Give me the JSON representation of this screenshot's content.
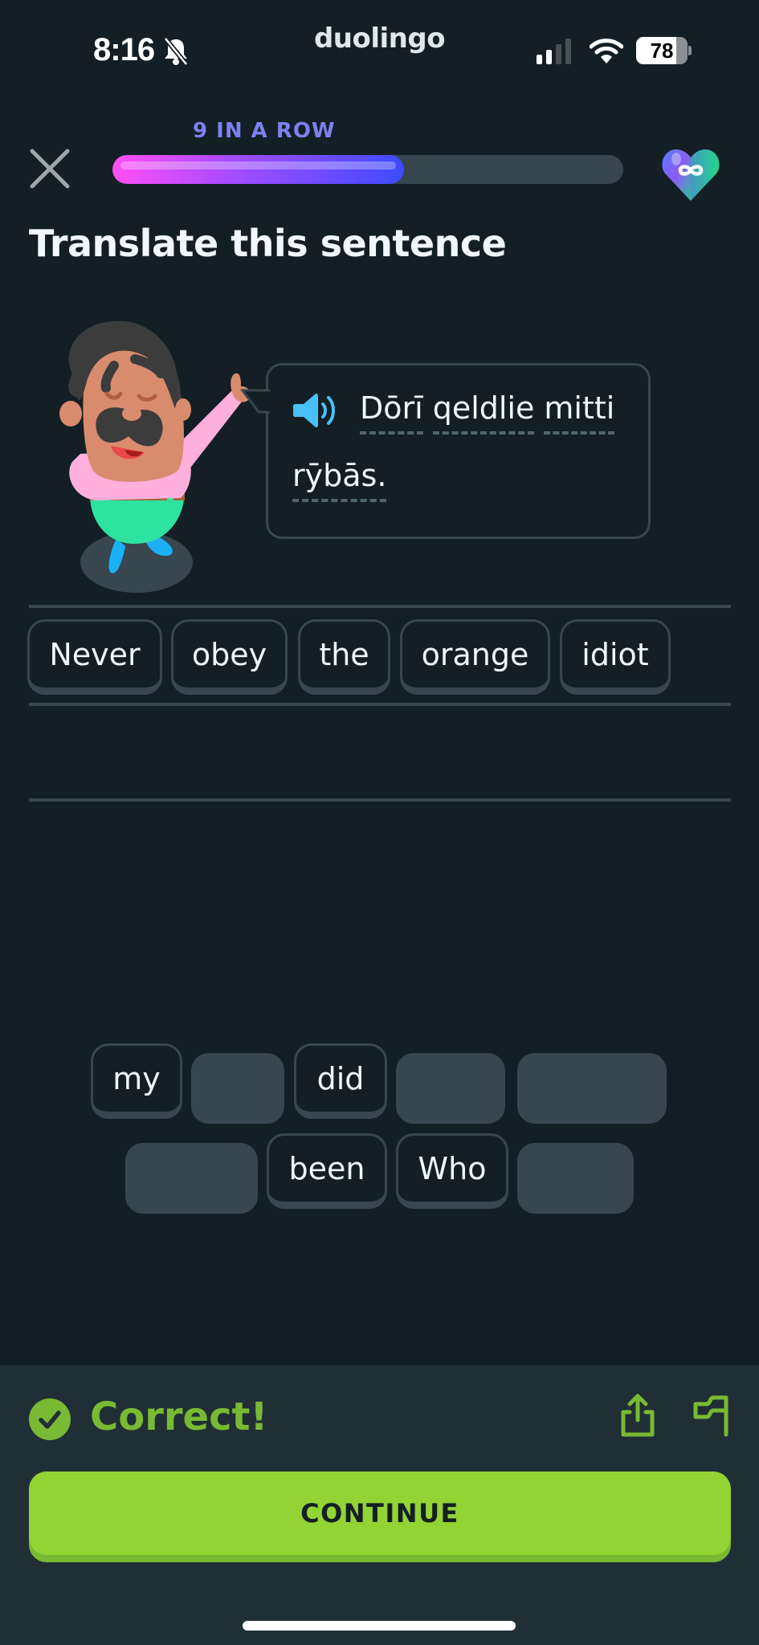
{
  "status_bar": {
    "time": "8:16",
    "app_name": "duolingo",
    "battery_percent": "78",
    "battery_level": 0.78,
    "icons": [
      "bell-slash-icon",
      "cellular-signal-icon",
      "wifi-icon",
      "battery-icon"
    ]
  },
  "header": {
    "streak_label": "9 IN A ROW",
    "lesson_progress": 0.57,
    "close_icon": "close-icon",
    "hearts_icon": "infinite-hearts-icon",
    "colors": {
      "streak": "#7c81f2",
      "progress_start": "#ff4ff5",
      "progress_end": "#3d4bff"
    }
  },
  "challenge": {
    "title": "Translate this sentence",
    "speaker_icon": "speaker-icon",
    "sentence_line1": [
      "Dōrī",
      "qeldlie",
      "mitti"
    ],
    "sentence_line2": [
      "rȳbās."
    ]
  },
  "answer": {
    "selected_words": [
      "Never",
      "obey",
      "the",
      "orange",
      "idiot"
    ]
  },
  "word_bank": {
    "row1": [
      {
        "word": "my",
        "used": false
      },
      {
        "word": "",
        "used": true
      },
      {
        "word": "did",
        "used": false
      },
      {
        "word": "",
        "used": true
      },
      {
        "word": "",
        "used": true
      }
    ],
    "row2": [
      {
        "word": "",
        "used": true
      },
      {
        "word": "been",
        "used": false
      },
      {
        "word": "Who",
        "used": false
      },
      {
        "word": "",
        "used": true
      }
    ]
  },
  "feedback": {
    "status": "Correct!",
    "continue_label": "CONTINUE",
    "colors": {
      "accent": "#79b933",
      "button": "#93d333",
      "button_shadow": "#79b933",
      "panel": "#202f36"
    }
  }
}
